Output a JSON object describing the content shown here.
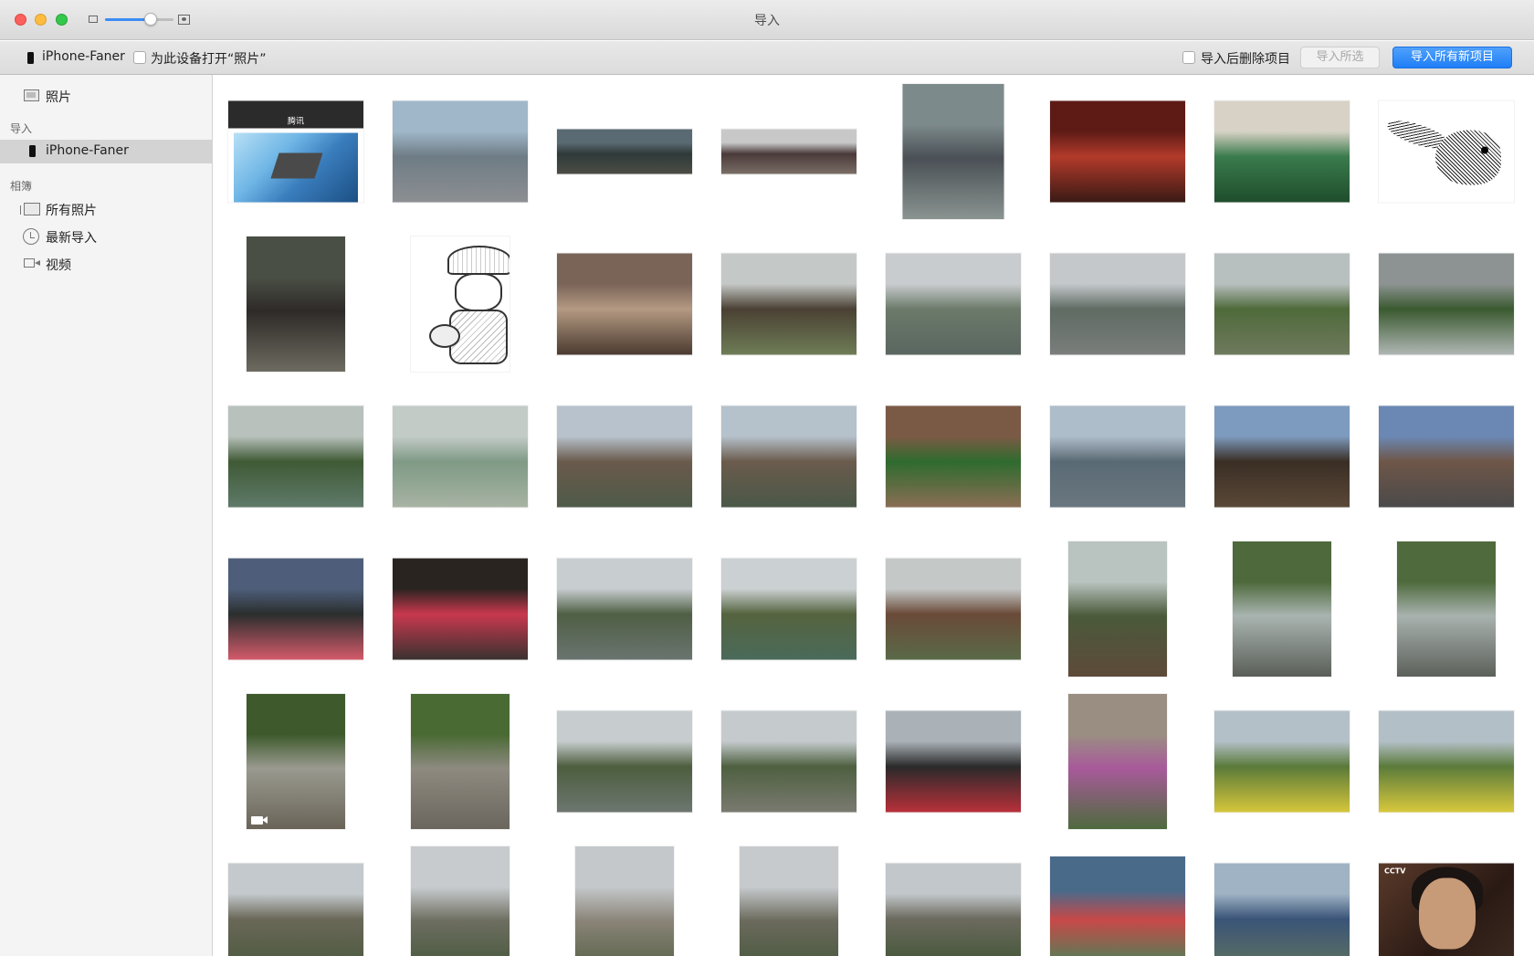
{
  "window": {
    "title": "导入"
  },
  "toolbar": {
    "device_name": "iPhone-Faner",
    "open_photos_label": "为此设备打开“照片”",
    "delete_after_import_label": "导入后删除项目",
    "import_selected_label": "导入所选",
    "import_all_new_label": "导入所有新项目",
    "accent_color": "#1f7ef7"
  },
  "sidebar": {
    "photos_label": "照片",
    "import_section": "导入",
    "device_label": "iPhone-Faner",
    "albums_section": "相簿",
    "albums": [
      {
        "label": "所有照片",
        "icon": "all-photos-icon"
      },
      {
        "label": "最新导入",
        "icon": "clock-icon"
      },
      {
        "label": "视频",
        "icon": "video-icon"
      }
    ]
  },
  "thumbnails": [
    {
      "id": "wechat-screenshot",
      "kind": "screenshot",
      "shape": "land",
      "title": "腾讯",
      "video": false
    },
    {
      "id": "plaza-buildings",
      "shape": "land",
      "colors": [
        "#9fb7c9",
        "#6e7c85",
        "#8c8f92"
      ],
      "video": false
    },
    {
      "id": "crowd-panorama-1",
      "shape": "wide",
      "colors": [
        "#5a6a72",
        "#2f3a3a",
        "#4b4d44"
      ],
      "video": false
    },
    {
      "id": "crowd-panorama-2",
      "shape": "wide",
      "colors": [
        "#c8c8c8",
        "#4a3a3a",
        "#7a6e66"
      ],
      "video": false
    },
    {
      "id": "aerial-crowd",
      "shape": "port",
      "colors": [
        "#7d8a8c",
        "#4a5055",
        "#8a9491"
      ],
      "video": false
    },
    {
      "id": "red-lanterns",
      "shape": "land",
      "colors": [
        "#5e1b16",
        "#b23a2a",
        "#3a1a15"
      ],
      "video": false
    },
    {
      "id": "mahjong-selfie",
      "shape": "land",
      "colors": [
        "#d8d2c6",
        "#3a7b4c",
        "#1e4d2c"
      ],
      "video": false
    },
    {
      "id": "duck-rabbit",
      "kind": "rabbit",
      "shape": "land",
      "video": false
    },
    {
      "id": "subway-crowd",
      "shape": "tall",
      "colors": [
        "#4a4f45",
        "#2e2a28",
        "#6d6b60"
      ],
      "video": false
    },
    {
      "id": "guitar-sketch",
      "kind": "sketch",
      "shape": "tall",
      "video": false
    },
    {
      "id": "old-building",
      "shape": "land",
      "colors": [
        "#7a6458",
        "#b49a82",
        "#4a3a30"
      ],
      "video": false
    },
    {
      "id": "bicycles-shed",
      "shape": "land",
      "colors": [
        "#c4c8c6",
        "#4a4033",
        "#6e7d56"
      ],
      "video": false
    },
    {
      "id": "lake-1",
      "shape": "land",
      "colors": [
        "#c9ccce",
        "#6b7a6a",
        "#5a6660"
      ],
      "video": false
    },
    {
      "id": "lake-pavilion",
      "shape": "land",
      "colors": [
        "#c4c8cb",
        "#5f6b63",
        "#7a7e7c"
      ],
      "video": false
    },
    {
      "id": "forest-lake",
      "shape": "land",
      "colors": [
        "#b8bfbf",
        "#4e6a3a",
        "#6f7a5e"
      ],
      "video": false
    },
    {
      "id": "moon-gate",
      "shape": "land",
      "colors": [
        "#8d9392",
        "#3a5a30",
        "#b0b6b4"
      ],
      "video": false
    },
    {
      "id": "green-lake-1",
      "shape": "land",
      "colors": [
        "#b8c1bc",
        "#3f5a35",
        "#5f7a6a"
      ],
      "video": false
    },
    {
      "id": "green-lake-2",
      "shape": "land",
      "colors": [
        "#c3cbc7",
        "#7f9a86",
        "#a7b3a4"
      ],
      "video": false
    },
    {
      "id": "church-street-1",
      "shape": "land",
      "colors": [
        "#b7c2cc",
        "#6a5a4c",
        "#4f5a48"
      ],
      "video": false
    },
    {
      "id": "church-street-2",
      "shape": "land",
      "colors": [
        "#b5c1cb",
        "#6b5b4d",
        "#4a5847"
      ],
      "video": false
    },
    {
      "id": "lawn-garden",
      "shape": "land",
      "colors": [
        "#7b5a45",
        "#2f6b2e",
        "#8a6e55"
      ],
      "video": false
    },
    {
      "id": "lake-village",
      "shape": "land",
      "colors": [
        "#aebdca",
        "#5a6a74",
        "#6a7780"
      ],
      "video": false
    },
    {
      "id": "chalet-night",
      "shape": "land",
      "colors": [
        "#7d9bbf",
        "#3a2e24",
        "#5a4838"
      ],
      "video": false
    },
    {
      "id": "german-town",
      "shape": "land",
      "colors": [
        "#6b88b4",
        "#6e5648",
        "#4b4a4a"
      ],
      "video": false
    },
    {
      "id": "heart-arch-1",
      "shape": "land",
      "colors": [
        "#4e5e7a",
        "#2a2e2e",
        "#d45a6a"
      ],
      "video": false
    },
    {
      "id": "heart-arch-2",
      "shape": "land",
      "colors": [
        "#2a2420",
        "#c8384e",
        "#3a3230"
      ],
      "video": false
    },
    {
      "id": "valley-lake-1",
      "shape": "land",
      "colors": [
        "#c8cdd0",
        "#4f5f44",
        "#6a7470"
      ],
      "video": false
    },
    {
      "id": "valley-canal",
      "shape": "land",
      "colors": [
        "#cbd0d2",
        "#55643f",
        "#4a6a5a"
      ],
      "video": false
    },
    {
      "id": "brick-house",
      "shape": "land",
      "colors": [
        "#c4c9c8",
        "#6a4a38",
        "#5a6a48"
      ],
      "video": false
    },
    {
      "id": "brick-house-tall",
      "shape": "tall",
      "colors": [
        "#b9c3bf",
        "#4a5a3a",
        "#5e4a3a"
      ],
      "video": false
    },
    {
      "id": "waterfall-rail-1",
      "shape": "tall",
      "colors": [
        "#4e6a3c",
        "#a9b4b0",
        "#5a5e58"
      ],
      "video": false
    },
    {
      "id": "waterfall-rail-2",
      "shape": "tall",
      "colors": [
        "#4f6b3d",
        "#a8b2ae",
        "#5c605a"
      ],
      "video": false
    },
    {
      "id": "waterfall-video",
      "shape": "tall",
      "colors": [
        "#3e5a2c",
        "#9a9a90",
        "#6a6458"
      ],
      "video": true
    },
    {
      "id": "waterfall-rocks",
      "shape": "tall",
      "colors": [
        "#4a6a34",
        "#8e8a80",
        "#6a665e"
      ],
      "video": false
    },
    {
      "id": "valley-lake-2",
      "shape": "land",
      "colors": [
        "#c7ccce",
        "#4d5e3e",
        "#6c7670"
      ],
      "video": false
    },
    {
      "id": "valley-village",
      "shape": "land",
      "colors": [
        "#c5cbcd",
        "#4e6040",
        "#7a7a70"
      ],
      "video": false
    },
    {
      "id": "fence-banners",
      "shape": "land",
      "colors": [
        "#aab2b8",
        "#2a2a2a",
        "#b8303a"
      ],
      "video": false
    },
    {
      "id": "flower-path",
      "shape": "tall",
      "colors": [
        "#9a8e82",
        "#a85a9a",
        "#4e6a3e"
      ],
      "video": false
    },
    {
      "id": "rapeseed-field-1",
      "shape": "land",
      "colors": [
        "#b4c0c8",
        "#5a7a3a",
        "#d6c63a"
      ],
      "video": false
    },
    {
      "id": "rapeseed-field-2",
      "shape": "land",
      "colors": [
        "#b3bfc7",
        "#5b7b3b",
        "#d8c83c"
      ],
      "video": false
    },
    {
      "id": "blossom-path-1",
      "shape": "land",
      "colors": [
        "#c3c9cc",
        "#6a6858",
        "#4e5a40"
      ],
      "video": false
    },
    {
      "id": "blossom-tree-1",
      "shape": "tall",
      "colors": [
        "#c7cbce",
        "#6d6e60",
        "#3e5234"
      ],
      "video": false
    },
    {
      "id": "blossom-tree-2",
      "shape": "tall",
      "colors": [
        "#c4c8cb",
        "#8a8478",
        "#4a5a3c"
      ],
      "video": false
    },
    {
      "id": "blossom-path-2",
      "shape": "tall",
      "colors": [
        "#c6cacd",
        "#6b6a5c",
        "#3f5436"
      ],
      "video": false
    },
    {
      "id": "blossom-path-3",
      "shape": "land",
      "colors": [
        "#c1c7ca",
        "#6c6a5e",
        "#435638"
      ],
      "video": false
    },
    {
      "id": "ribbon-tunnel",
      "shape": "square",
      "colors": [
        "#4a6a8a",
        "#c84848",
        "#3a8a5a"
      ],
      "video": true
    },
    {
      "id": "windmill-lake",
      "shape": "land",
      "colors": [
        "#9fb3c4",
        "#3a5478",
        "#5a6f62"
      ],
      "video": false
    },
    {
      "id": "tv-drama",
      "kind": "tv",
      "shape": "land",
      "channel": "CCTV",
      "video": false
    }
  ]
}
